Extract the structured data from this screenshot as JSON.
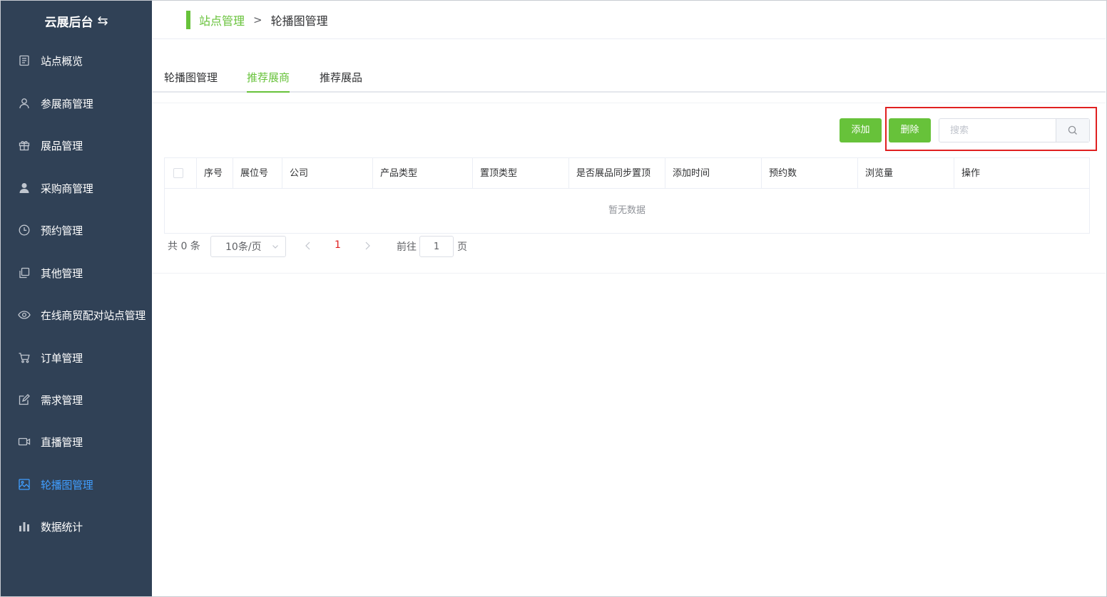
{
  "brand": {
    "title": "云展后台",
    "swap_glyph": "⇆"
  },
  "sidebar": {
    "items": [
      {
        "label": "站点概览",
        "icon": "document-icon"
      },
      {
        "label": "参展商管理",
        "icon": "user-icon"
      },
      {
        "label": "展品管理",
        "icon": "gift-icon"
      },
      {
        "label": "采购商管理",
        "icon": "person-filled-icon"
      },
      {
        "label": "预约管理",
        "icon": "clock-icon"
      },
      {
        "label": "其他管理",
        "icon": "copy-icon"
      },
      {
        "label": "在线商贸配对站点管理",
        "icon": "eye-icon"
      },
      {
        "label": "订单管理",
        "icon": "cart-icon"
      },
      {
        "label": "需求管理",
        "icon": "edit-icon"
      },
      {
        "label": "直播管理",
        "icon": "video-icon"
      },
      {
        "label": "轮播图管理",
        "icon": "picture-icon",
        "active": true
      },
      {
        "label": "数据统计",
        "icon": "bar-chart-icon"
      }
    ]
  },
  "breadcrumb": {
    "parent": "站点管理",
    "separator": ">",
    "current": "轮播图管理"
  },
  "tabs": [
    {
      "label": "轮播图管理"
    },
    {
      "label": "推荐展商",
      "active": true
    },
    {
      "label": "推荐展品"
    }
  ],
  "toolbar": {
    "add_label": "添加",
    "delete_label": "删除",
    "search_placeholder": "搜索"
  },
  "table": {
    "columns": [
      "序号",
      "展位号",
      "公司",
      "产品类型",
      "置顶类型",
      "是否展品同步置顶",
      "添加时间",
      "预约数",
      "浏览量",
      "操作"
    ],
    "empty_text": "暂无数据"
  },
  "pagination": {
    "total_text": "共 0 条",
    "page_size": "10条/页",
    "current_page": "1",
    "goto_label": "前往",
    "goto_value": "1",
    "page_unit": "页"
  },
  "colors": {
    "sidebar_bg": "#304156",
    "accent_green": "#67c23a",
    "active_blue": "#409eff",
    "highlight_red": "#e02020"
  }
}
